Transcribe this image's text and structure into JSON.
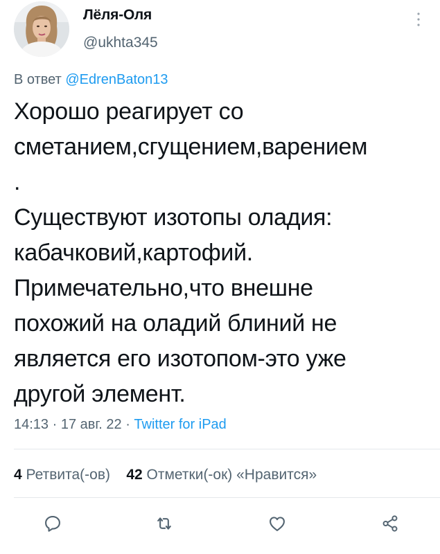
{
  "tweet": {
    "display_name": "Лёля-Оля",
    "handle": "@ukhta345",
    "reply_prefix": "В ответ",
    "reply_mention": "@EdrenBaton13",
    "text": "Хорошо реагирует со\nсметанием,сгущением,варением\n.\nСуществуют изотопы оладия:\nкабачковий,картофий.\nПримечательно,что внешне\nпохожий на оладий блиний не\nявляется его изотопом-это уже\nдругой элемент.",
    "time": "14:13",
    "date": "17 авг. 22",
    "separator": "·",
    "source": "Twitter for iPad"
  },
  "stats": {
    "retweets_count": "4",
    "retweets_label": "Ретвита(-ов)",
    "likes_count": "42",
    "likes_label": "Отметки(-ок) «Нравится»"
  },
  "icons": {
    "reply": "reply-icon",
    "retweet": "retweet-icon",
    "like": "heart-icon",
    "share": "share-icon",
    "more": "more-vertical-icon"
  },
  "colors": {
    "text": "#0f1419",
    "secondary": "#536471",
    "link": "#1d9bf0",
    "divider": "#e4e7eb"
  }
}
